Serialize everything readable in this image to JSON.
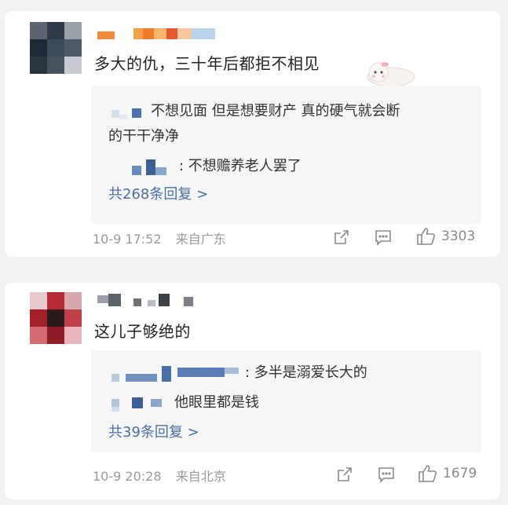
{
  "comments": [
    {
      "text": "多大的仇，三十年后都拒不相见",
      "replies": [
        {
          "text": "不想见面 但是想要财产 真的硬气就会断"
        },
        {
          "text": "的干干净净"
        },
        {
          "text": ": 不想赡养老人罢了"
        }
      ],
      "more_replies": "共268条回复 >",
      "date": "10-9 17:52",
      "location": "来自广东",
      "likes": "3303"
    },
    {
      "text": "这儿子够绝的",
      "replies": [
        {
          "text": ": 多半是溺爱长大的"
        },
        {
          "text": "他眼里都是钱"
        }
      ],
      "more_replies": "共39条回复 >",
      "date": "10-9 20:28",
      "location": "来自北京",
      "likes": "1679"
    }
  ],
  "icons": {
    "share": "share-icon",
    "comment": "comment-icon",
    "like": "thumbs-up-icon"
  },
  "colors": {
    "link": "#4a6ea8",
    "meta": "#9a9a9a",
    "reply_bg": "#f6f6f6"
  }
}
